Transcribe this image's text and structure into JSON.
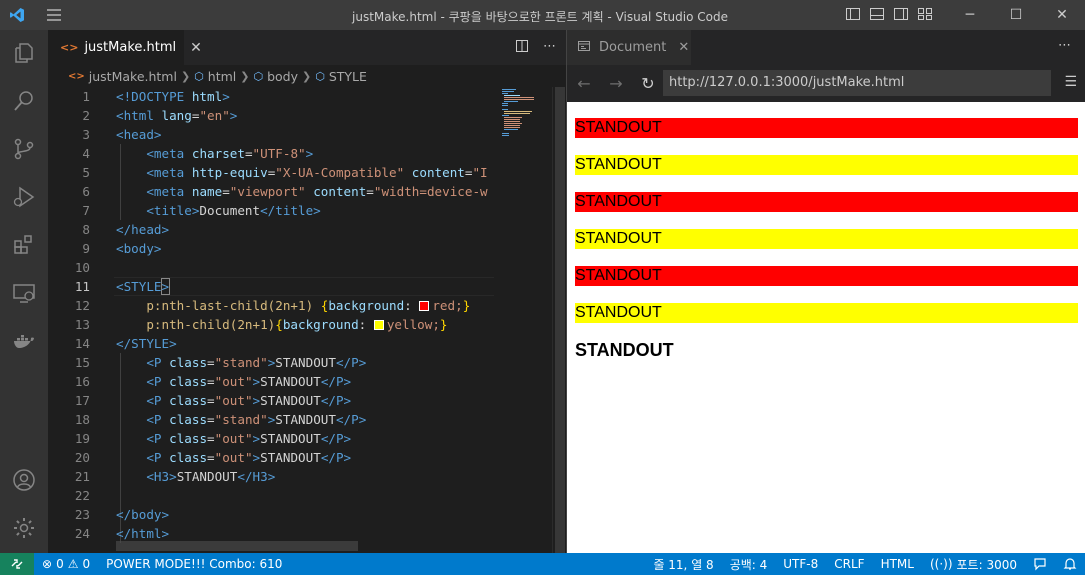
{
  "window": {
    "title": "justMake.html - 쿠팡을 바탕으로한 프론트 계획 - Visual Studio Code",
    "minimize": "─",
    "maximize": "☐",
    "close": "✕"
  },
  "editor": {
    "tab_label": "justMake.html",
    "breadcrumb": [
      "justMake.html",
      "html",
      "body",
      "STYLE"
    ],
    "current_line": 11,
    "lines": [
      {
        "n": "1"
      },
      {
        "n": "2"
      },
      {
        "n": "3"
      },
      {
        "n": "4"
      },
      {
        "n": "5"
      },
      {
        "n": "6"
      },
      {
        "n": "7"
      },
      {
        "n": "8"
      },
      {
        "n": "9"
      },
      {
        "n": "10"
      },
      {
        "n": "11"
      },
      {
        "n": "12"
      },
      {
        "n": "13"
      },
      {
        "n": "14"
      },
      {
        "n": "15"
      },
      {
        "n": "16"
      },
      {
        "n": "17"
      },
      {
        "n": "18"
      },
      {
        "n": "19"
      },
      {
        "n": "20"
      },
      {
        "n": "21"
      },
      {
        "n": "22"
      },
      {
        "n": "23"
      },
      {
        "n": "24"
      }
    ],
    "code": {
      "doctype": "<!DOCTYPE",
      "doctype_html": "html",
      "doctype_end": ">",
      "meta_charset_val": "\"UTF-8\"",
      "meta_http_val": "\"X-UA-Compatible\"",
      "meta_content_trunc": "\"I",
      "meta_vp_name": "\"viewport\"",
      "meta_vp_content": "\"width=device-w",
      "title_text": "Document",
      "lang_val": "\"en\"",
      "rule1_selector": "p:nth-last-child(2n+1)",
      "rule1_prop": "background",
      "rule1_value": "red;",
      "rule2_selector": "p:nth-child(2n+1)",
      "rule2_prop": "background",
      "rule2_value": "yellow;",
      "p_text": "STANDOUT",
      "class_stand": "\"stand\"",
      "class_out": "\"out\""
    }
  },
  "preview": {
    "tab_label": "Document",
    "url": "http://127.0.0.1:3000/justMake.html",
    "paragraphs": [
      {
        "text": "STANDOUT",
        "bg": "#ff0000"
      },
      {
        "text": "STANDOUT",
        "bg": "#ffff00"
      },
      {
        "text": "STANDOUT",
        "bg": "#ff0000"
      },
      {
        "text": "STANDOUT",
        "bg": "#ffff00"
      },
      {
        "text": "STANDOUT",
        "bg": "#ff0000"
      },
      {
        "text": "STANDOUT",
        "bg": "#ffff00"
      }
    ],
    "heading": "STANDOUT"
  },
  "status": {
    "errors": "0",
    "warnings": "0",
    "power_mode": "POWER MODE!!! Combo: 610",
    "position": "줄 11, 열 8",
    "spaces": "공백: 4",
    "encoding": "UTF-8",
    "eol": "CRLF",
    "language": "HTML",
    "port": "포트: 3000"
  },
  "colors": {
    "accent": "#007acc",
    "remote": "#16825d",
    "red_bg": "#ff0000",
    "yellow_bg": "#ffff00"
  }
}
